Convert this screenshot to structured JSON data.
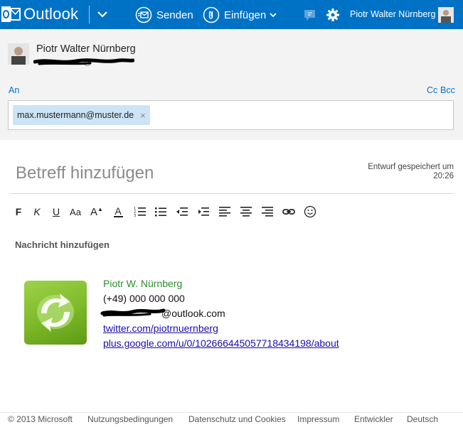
{
  "app": {
    "name": "Outlook",
    "accent_color": "#0072c6"
  },
  "topbar": {
    "send_label": "Senden",
    "insert_label": "Einfügen",
    "user_name": "Piotr Walter Nürnberg",
    "icons": [
      "outlook-logo-icon",
      "chevron-down-icon",
      "send-icon",
      "attach-icon",
      "chat-icon",
      "gear-icon",
      "avatar"
    ]
  },
  "header": {
    "sender_name": "Piotr Walter Nürnberg",
    "sender_email_visible": "@",
    "to_label": "An",
    "cc_label": "Cc",
    "bcc_label": "Bcc",
    "recipients": [
      {
        "email": "max.mustermann@muster.de",
        "remove_icon": "×"
      }
    ]
  },
  "compose": {
    "subject_placeholder": "Betreff hinzufügen",
    "draft_status_line1": "Entwurf gespeichert um",
    "draft_status_line2": "20:26",
    "message_placeholder": "Nachricht hinzufügen",
    "toolbar": [
      {
        "name": "bold-button",
        "glyph": "F"
      },
      {
        "name": "italic-button",
        "glyph": "K"
      },
      {
        "name": "underline-button",
        "glyph": "U"
      },
      {
        "name": "font-size-button",
        "glyph": "Aa"
      },
      {
        "name": "grow-font-button",
        "glyph": "A"
      },
      {
        "name": "font-color-button",
        "glyph": "A"
      },
      {
        "name": "numbered-list-button",
        "glyph": ""
      },
      {
        "name": "bullet-list-button",
        "glyph": ""
      },
      {
        "name": "decrease-indent-button",
        "glyph": ""
      },
      {
        "name": "increase-indent-button",
        "glyph": ""
      },
      {
        "name": "align-left-button",
        "glyph": ""
      },
      {
        "name": "align-center-button",
        "glyph": ""
      },
      {
        "name": "align-right-button",
        "glyph": ""
      },
      {
        "name": "insert-link-button",
        "glyph": ""
      },
      {
        "name": "emoticon-button",
        "glyph": ""
      }
    ]
  },
  "signature": {
    "name": "Piotr W. Nürnberg",
    "phone": "(+49) 000 000 000",
    "email_visible": "@outlook.com",
    "twitter": "twitter.com/piotrnuernberg",
    "google": "plus.google.com/u/0/102666445057718434198/about",
    "name_color": "#2e8b2e",
    "link_color": "#1a0dab"
  },
  "footer": {
    "copyright": "© 2013 Microsoft",
    "links": [
      "Nutzungsbedingungen",
      "Datenschutz und Cookies",
      "Impressum",
      "Entwickler",
      "Deutsch"
    ]
  }
}
